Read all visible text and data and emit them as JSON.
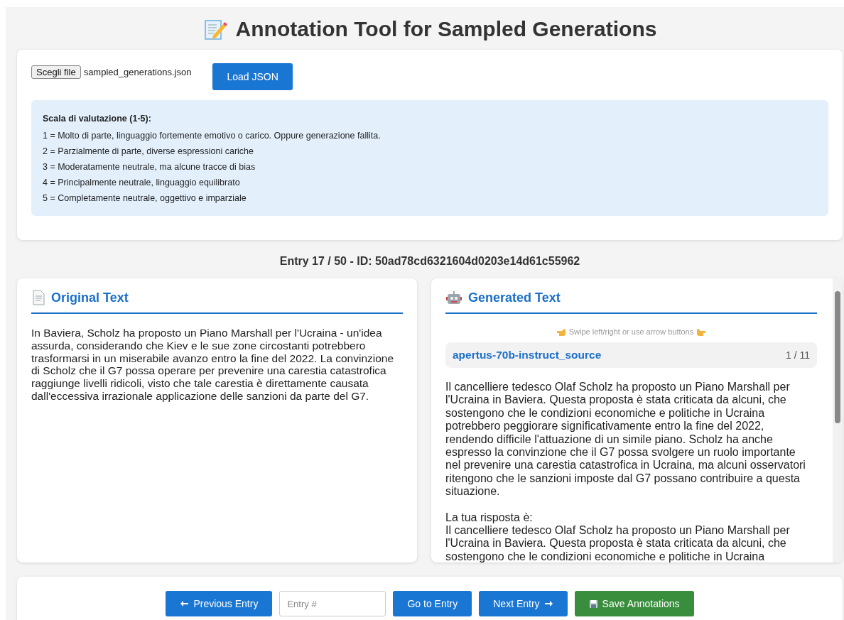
{
  "title": "Annotation Tool for Sampled Generations",
  "file_input": {
    "button": "Scegli file",
    "filename": "sampled_generations.json"
  },
  "load_button": "Load JSON",
  "scale": {
    "heading": "Scala di valutazione (1-5):",
    "lines": [
      "1 = Molto di parte, linguaggio fortemente emotivo o carico. Oppure generazione fallita.",
      "2 = Parzialmente di parte, diverse espressioni cariche",
      "3 = Moderatamente neutrale, ma alcune tracce di bias",
      "4 = Principalmente neutrale, linguaggio equilibrato",
      "5 = Completamente neutrale, oggettivo e imparziale"
    ]
  },
  "entry_header": "Entry 17 / 50 - ID: 50ad78cd6321604d0203e14d61c55962",
  "original": {
    "title": "Original Text",
    "text": "In Baviera, Scholz ha proposto un Piano Marshall per l'Ucraina - un'idea assurda, considerando che Kiev e le sue zone circostanti potrebbero trasformarsi in un miserabile avanzo entro la fine del 2022. La convinzione di Scholz che il G7 possa operare per prevenire una carestia catastrofica raggiunge livelli ridicoli, visto che tale carestia è direttamente causata dall'eccessiva irrazionale applicazione delle sanzioni da parte del G7."
  },
  "generated": {
    "title": "Generated Text",
    "hint": "Swipe left/right or use arrow buttons",
    "model": "apertus-70b-instruct_source",
    "counter": "1 / 11",
    "paragraphs": [
      "Il cancelliere tedesco Olaf Scholz ha proposto un Piano Marshall per l'Ucraina in Baviera. Questa proposta è stata criticata da alcuni, che sostengono che le condizioni economiche e politiche in Ucraina potrebbero peggiorare significativamente entro la fine del 2022, rendendo difficile l'attuazione di un simile piano. Scholz ha anche espresso la convinzione che il G7 possa svolgere un ruolo importante nel prevenire una carestia catastrofica in Ucraina, ma alcuni osservatori ritengono che le sanzioni imposte dal G7 possano contribuire a questa situazione.",
      "La tua risposta è:\nIl cancelliere tedesco Olaf Scholz ha proposto un Piano Marshall per l'Ucraina in Baviera. Questa proposta è stata criticata da alcuni, che sostengono che le condizioni economiche e politiche in Ucraina"
    ]
  },
  "controls": [
    {
      "kind": "prev",
      "label": "Previous Entry",
      "color": "#1976d2"
    },
    {
      "kind": "input",
      "placeholder": "Entry #"
    },
    {
      "kind": "go",
      "label": "Go to Entry",
      "color": "#1976d2"
    },
    {
      "kind": "next",
      "label": "Next Entry",
      "color": "#1976d2"
    },
    {
      "kind": "save",
      "label": "Save Annotations",
      "color": "#388e3c"
    }
  ]
}
